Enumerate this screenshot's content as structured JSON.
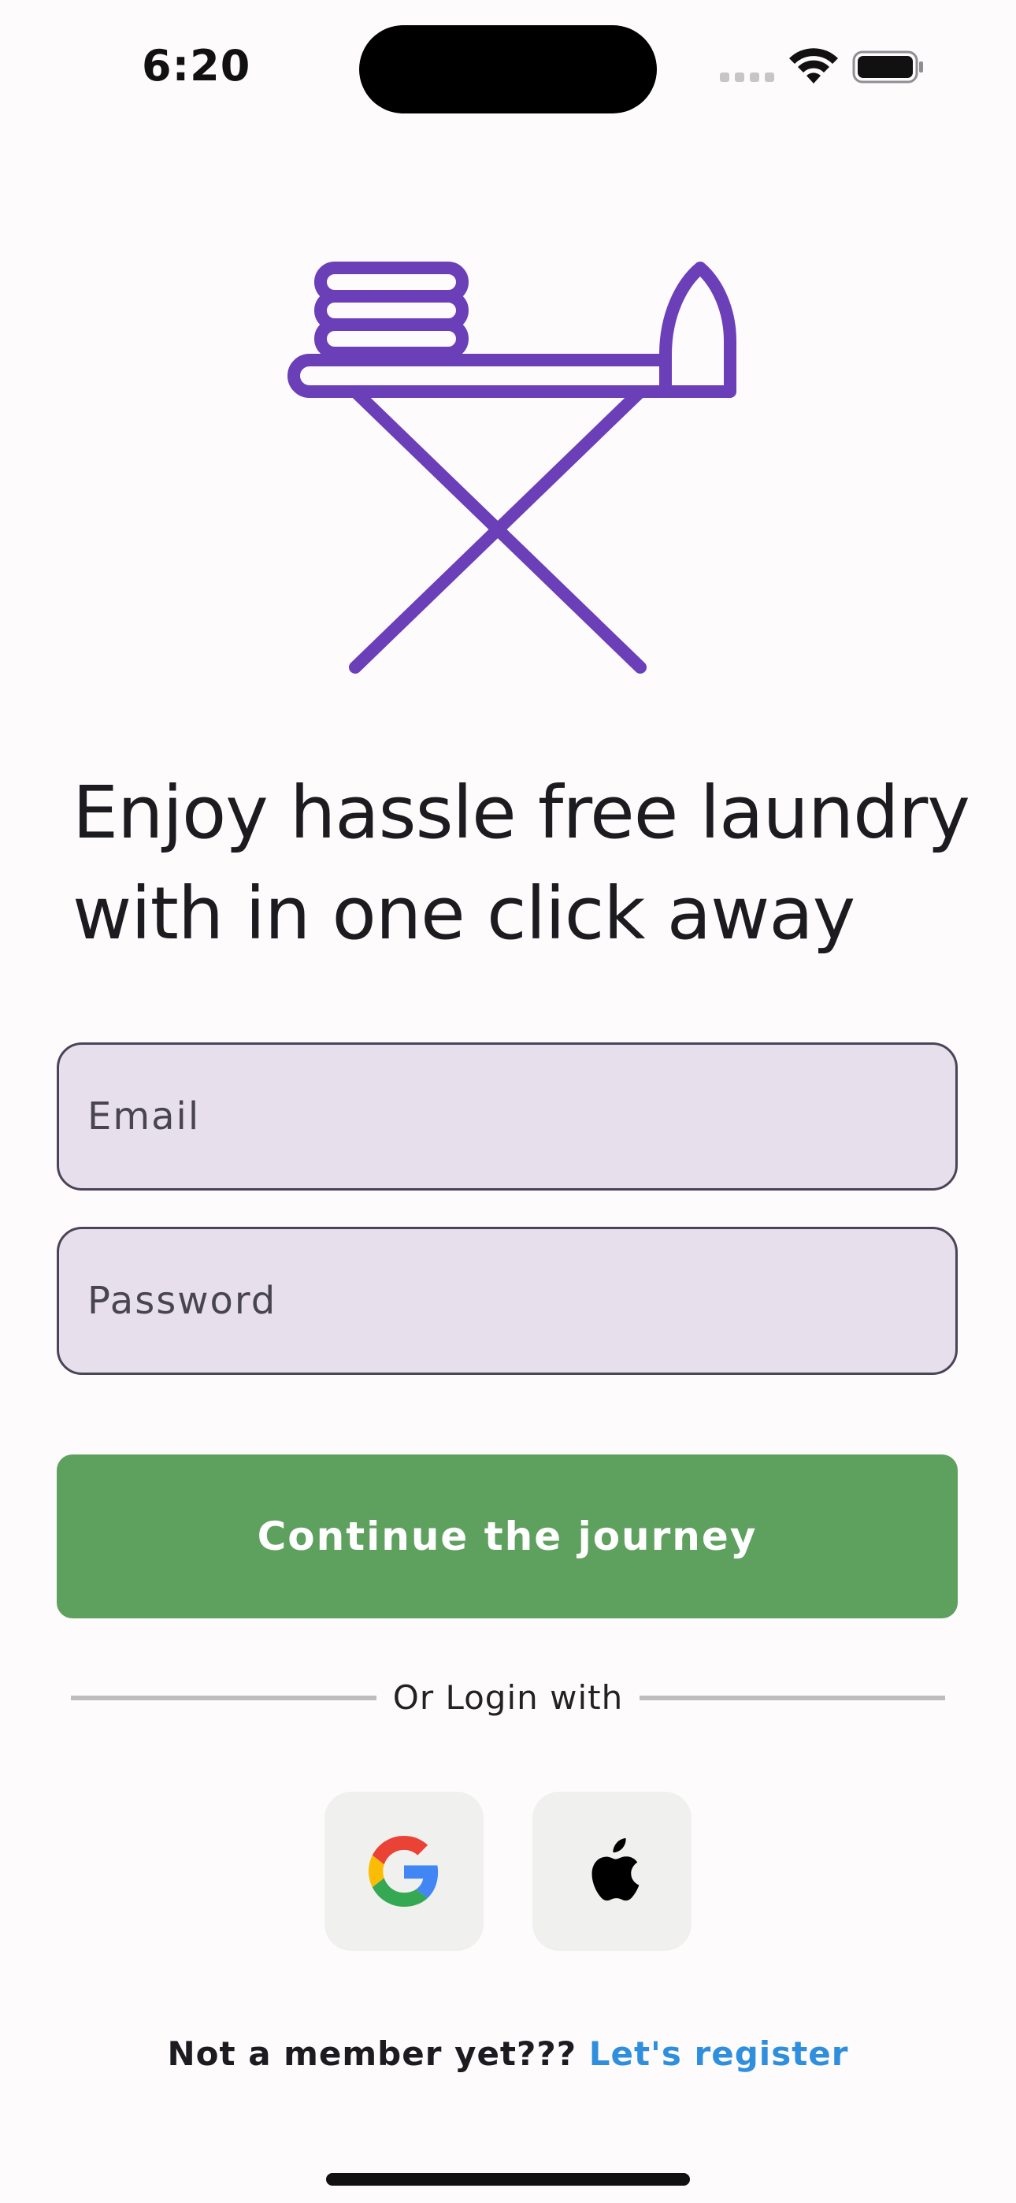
{
  "status_bar": {
    "time": "6:20"
  },
  "headline": {
    "line1": "Enjoy hassle free laundry",
    "line2": "with in one click away"
  },
  "form": {
    "email_placeholder": "Email",
    "password_placeholder": "Password",
    "submit_label": "Continue the journey"
  },
  "divider": {
    "label": "Or Login with"
  },
  "social": {
    "google_icon": "google-logo-icon",
    "apple_icon": "apple-logo-icon"
  },
  "register": {
    "question": "Not a member yet???",
    "link": "Let's register"
  },
  "colors": {
    "accent_purple": "#6a3fb8",
    "primary_green": "#5ea05e",
    "link_blue": "#2f8fdc",
    "input_fill": "#e7e0ec"
  }
}
